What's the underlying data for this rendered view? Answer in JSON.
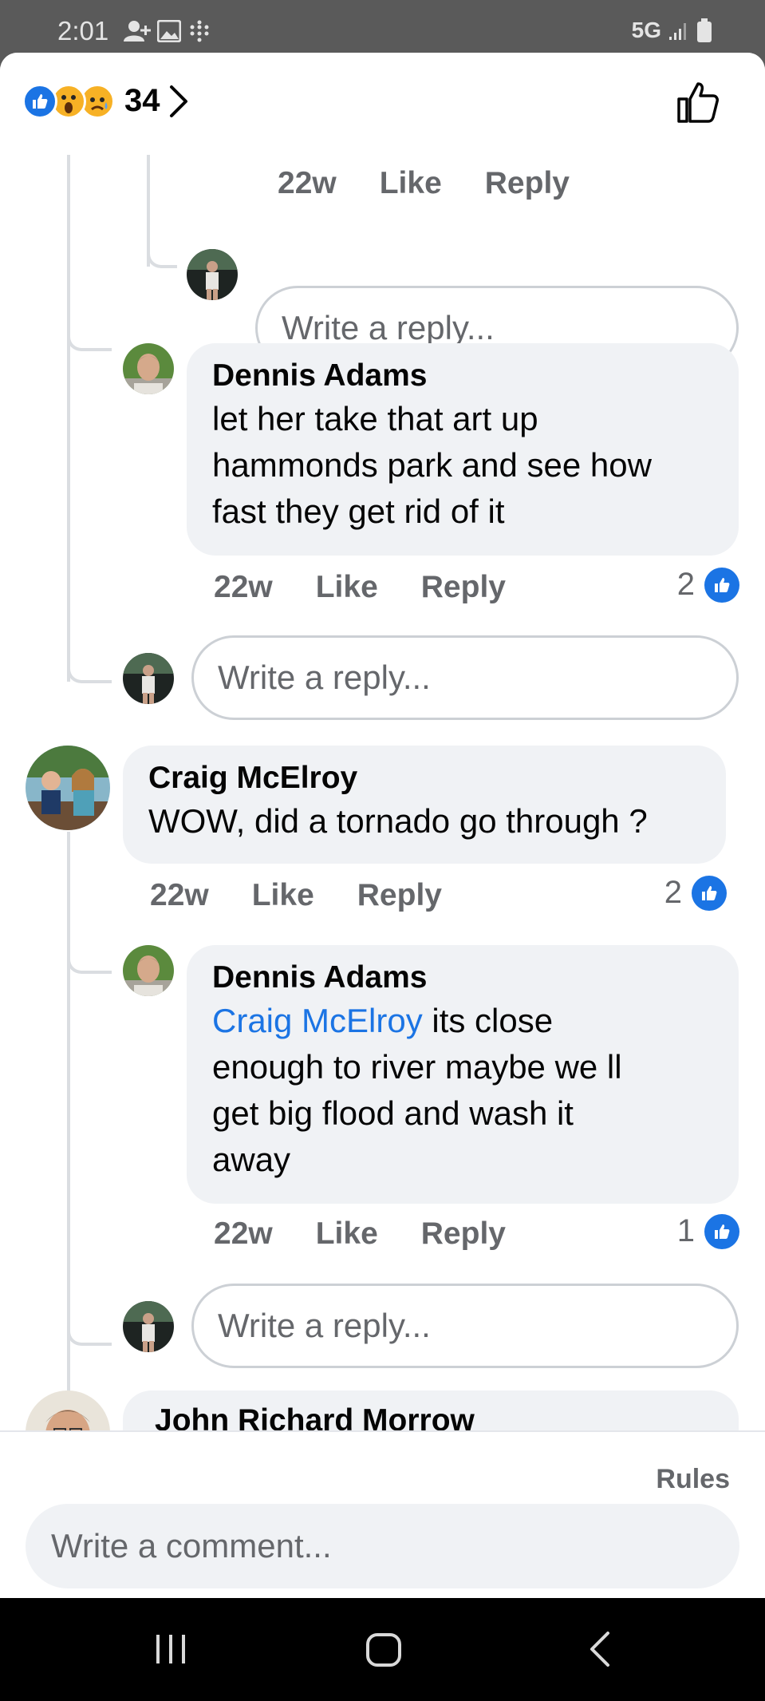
{
  "status_bar": {
    "time": "2:01",
    "network": "5G"
  },
  "header": {
    "reaction_count": "34"
  },
  "comments": {
    "top_meta": {
      "time": "22w",
      "like": "Like",
      "reply": "Reply"
    },
    "reply_input_1": {
      "placeholder": "Write a reply..."
    },
    "reply1": {
      "author": "Dennis Adams",
      "text_lines": [
        "let her take that art up",
        "hammonds park and see how",
        "fast they get rid of it"
      ],
      "time": "22w",
      "like": "Like",
      "reply": "Reply",
      "likes": "2"
    },
    "reply_input_2": {
      "placeholder": "Write a reply..."
    },
    "comment2": {
      "author": "Craig McElroy",
      "text": "WOW, did a tornado go through ?",
      "time": "22w",
      "like": "Like",
      "reply": "Reply",
      "likes": "2"
    },
    "reply2": {
      "author": "Dennis Adams",
      "mention": "Craig McElroy",
      "text_line1": " its close",
      "text_lines": [
        "enough to river maybe we ll",
        "get big flood and wash it",
        "away"
      ],
      "time": "22w",
      "like": "Like",
      "reply": "Reply",
      "likes": "1"
    },
    "reply_input_3": {
      "placeholder": "Write a reply..."
    },
    "next_comment": {
      "author": "John Richard Morrow"
    }
  },
  "footer": {
    "rules": "Rules",
    "comment_placeholder": "Write a comment..."
  },
  "colors": {
    "accent": "#1b74e4",
    "bubble": "#f0f2f5",
    "muted": "#65676b"
  }
}
